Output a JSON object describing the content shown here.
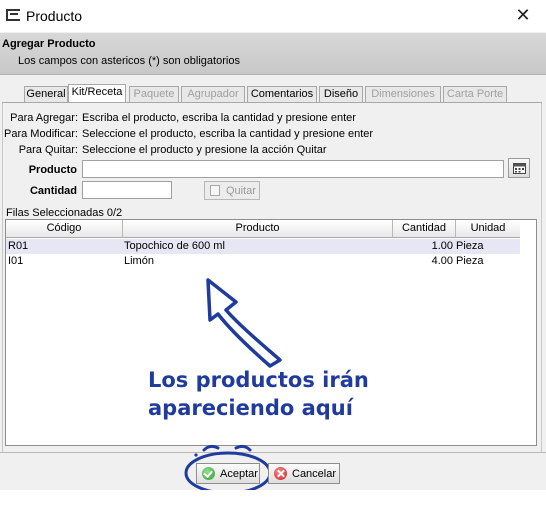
{
  "window": {
    "title": "Producto",
    "close_glyph": "✕"
  },
  "header": {
    "title": "Agregar Producto",
    "subtitle": "Los campos con astericos (*) son obligatorios"
  },
  "tabs": [
    {
      "label": "General",
      "state": "normal"
    },
    {
      "label": "Kit/Receta",
      "state": "active"
    },
    {
      "label": "Paquete",
      "state": "disabled"
    },
    {
      "label": "Agrupador",
      "state": "disabled"
    },
    {
      "label": "Comentarios",
      "state": "normal"
    },
    {
      "label": "Diseño",
      "state": "normal"
    },
    {
      "label": "Dimensiones",
      "state": "disabled"
    },
    {
      "label": "Carta Porte",
      "state": "disabled"
    }
  ],
  "instructions": [
    {
      "label": "Para Agregar:",
      "text": "Escriba el producto, escriba la cantidad y presione enter"
    },
    {
      "label": "Para Modificar:",
      "text": "Seleccione el producto, escriba la cantidad y presione enter"
    },
    {
      "label": "Para Quitar:",
      "text": "Seleccione el producto y presione la acción Quitar"
    }
  ],
  "form": {
    "producto_label": "Producto",
    "producto_value": "",
    "cantidad_label": "Cantidad",
    "cantidad_value": "",
    "quitar_label": "Quitar",
    "calendar_icon": "calendar-icon"
  },
  "table": {
    "summary": "Filas Seleccionadas 0/2",
    "columns": [
      "Código",
      "Producto",
      "Cantidad",
      "Unidad"
    ],
    "rows": [
      {
        "codigo": "R01",
        "producto": "Topochico de 600 ml",
        "cantidad": "1.00",
        "unidad": "Pieza",
        "selected": true
      },
      {
        "codigo": "I01",
        "producto": "Limón",
        "cantidad": "4.00",
        "unidad": "Pieza",
        "selected": false
      }
    ]
  },
  "annotation": {
    "line1": "Los productos irán",
    "line2": "apareciendo aquí",
    "color": "#1f3b9e"
  },
  "buttons": {
    "ok_label": "Aceptar",
    "cancel_label": "Cancelar"
  },
  "colors": {
    "accent_annotation": "#1f3b9e",
    "ok_green": "#2f9a2f",
    "cancel_red": "#c81e1e",
    "selected_row": "#e6e6f5"
  }
}
